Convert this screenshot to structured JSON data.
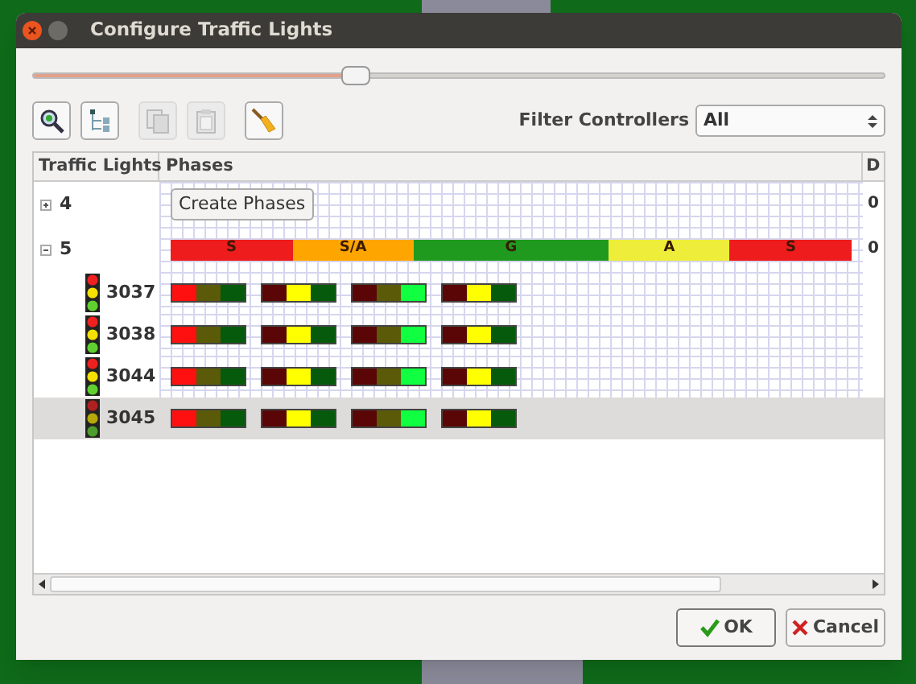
{
  "window": {
    "title": "Configure Traffic Lights"
  },
  "slider": {
    "level": 0.38
  },
  "toolbar": [
    {
      "kind": "zoom",
      "disabled": false
    },
    {
      "kind": "tree",
      "disabled": false
    },
    {
      "kind": "copy",
      "disabled": true
    },
    {
      "kind": "paste",
      "disabled": true
    },
    {
      "kind": "broom",
      "disabled": false
    }
  ],
  "filter": {
    "label": "Filter Controllers",
    "value": "All"
  },
  "table": {
    "columns": [
      "Traffic Lights",
      "Phases",
      "D"
    ],
    "rows": [
      {
        "id": "4",
        "expanded": false,
        "selected": false,
        "button": "Create Phases",
        "column_3": "0"
      },
      {
        "id": "5",
        "expanded": true,
        "selected": false,
        "column_3": "0",
        "phases": [
          {
            "label": "S",
            "color": "#ee1c1c"
          },
          {
            "label": "S/A",
            "color": "#ffa500"
          },
          {
            "label": "G",
            "color": "#1f9a1f"
          },
          {
            "label": "A",
            "color": "#eeee3a"
          },
          {
            "label": "S",
            "color": "#ee1c1c"
          }
        ],
        "children": [
          {
            "id": "3037",
            "selected": false,
            "lights": [
              {
                "red": true,
                "yellow": false,
                "green": false
              },
              {
                "red": false,
                "yellow": true,
                "green": false
              },
              {
                "red": false,
                "yellow": false,
                "green": true
              },
              {
                "red": false,
                "yellow": true,
                "green": false
              }
            ]
          },
          {
            "id": "3038",
            "selected": false,
            "lights": [
              {
                "red": true,
                "yellow": false,
                "green": false
              },
              {
                "red": false,
                "yellow": true,
                "green": false
              },
              {
                "red": false,
                "yellow": false,
                "green": true
              },
              {
                "red": false,
                "yellow": true,
                "green": false
              }
            ]
          },
          {
            "id": "3044",
            "selected": false,
            "lights": [
              {
                "red": true,
                "yellow": false,
                "green": false
              },
              {
                "red": false,
                "yellow": true,
                "green": false
              },
              {
                "red": false,
                "yellow": false,
                "green": true
              },
              {
                "red": false,
                "yellow": true,
                "green": false
              }
            ]
          },
          {
            "id": "3045",
            "selected": true,
            "lights": [
              {
                "red": true,
                "yellow": false,
                "green": false
              },
              {
                "red": false,
                "yellow": true,
                "green": false
              },
              {
                "red": false,
                "yellow": false,
                "green": true
              },
              {
                "red": false,
                "yellow": true,
                "green": false
              }
            ]
          }
        ]
      }
    ]
  },
  "buttons": [
    {
      "kind": "ok",
      "label": "OK"
    },
    {
      "kind": "cancel",
      "label": "Cancel"
    }
  ]
}
